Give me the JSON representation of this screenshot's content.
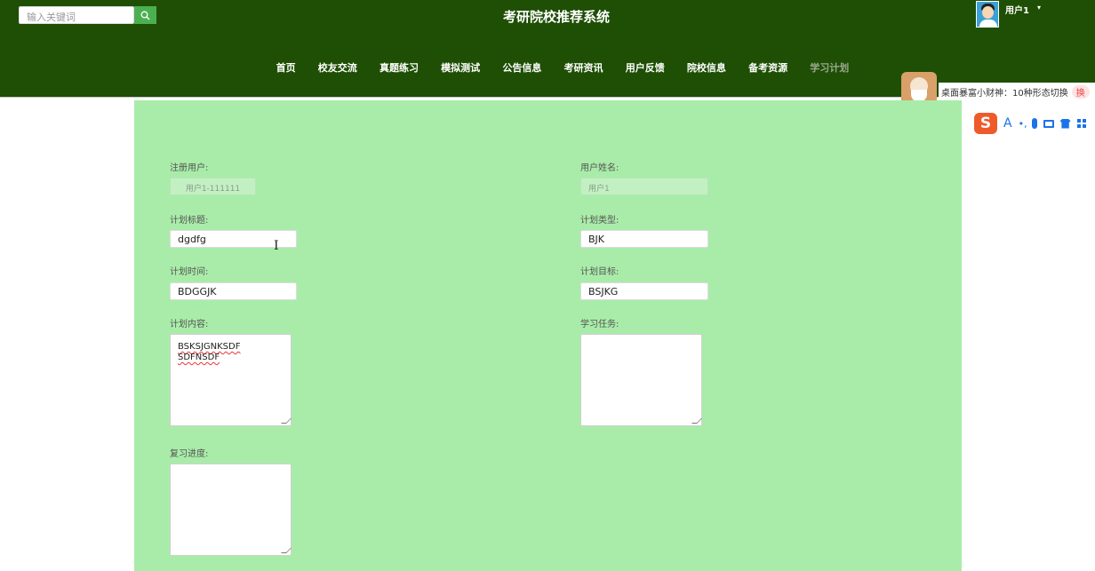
{
  "header": {
    "search_placeholder": "输入关键词",
    "title": "考研院校推荐系统",
    "user_name": "用户1",
    "caret": "▾"
  },
  "nav": {
    "items": [
      "首页",
      "校友交流",
      "真题练习",
      "模拟测试",
      "公告信息",
      "考研资讯",
      "用户反馈",
      "院校信息",
      "备考资源",
      "学习计划"
    ]
  },
  "promo": {
    "text": "桌面暴富小财神：10种形态切换",
    "badge": "换"
  },
  "ime": {
    "logo": "S",
    "a": "A",
    "punct": "•,"
  },
  "form": {
    "reg_user": {
      "label": "注册用户:",
      "value": "用户1-111111"
    },
    "user_name": {
      "label": "用户姓名:",
      "value": "用户1"
    },
    "plan_title": {
      "label": "计划标题:",
      "value": "dgdfg"
    },
    "plan_type": {
      "label": "计划类型:",
      "value": "BJK"
    },
    "plan_time": {
      "label": "计划时间:",
      "value": "BDGGJK"
    },
    "plan_goal": {
      "label": "计划目标:",
      "value": "BSJKG"
    },
    "plan_content": {
      "label": "计划内容:",
      "line1": "BSKSJGNKSDF",
      "line2": "SDFNSDF"
    },
    "study_task": {
      "label": "学习任务:",
      "value": ""
    },
    "review_progress": {
      "label": "复习进度:",
      "value": ""
    }
  },
  "colors": {
    "header_bg": "#1e4f04",
    "panel_bg": "#a9eca9",
    "search_btn": "#4caf50"
  }
}
